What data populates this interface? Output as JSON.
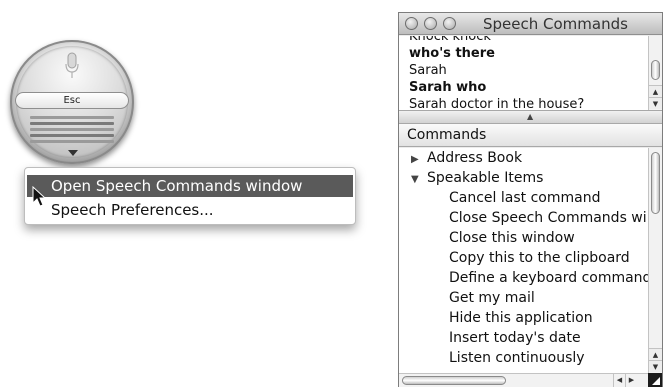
{
  "speech_widget": {
    "esc_label": "Esc",
    "icons": {
      "microphone": "microphone-icon",
      "menu_arrow": "triangle-down-icon"
    }
  },
  "context_menu": {
    "items": [
      {
        "label": "Open Speech Commands window",
        "selected": true
      },
      {
        "label": "Speech Preferences...",
        "selected": false
      }
    ]
  },
  "window": {
    "title": "Speech Commands",
    "log": [
      {
        "text": "Knock knock",
        "bold": false
      },
      {
        "text": "who's there",
        "bold": true
      },
      {
        "text": "Sarah",
        "bold": false
      },
      {
        "text": "Sarah who",
        "bold": true
      },
      {
        "text": "Sarah doctor in the house?",
        "bold": false
      }
    ],
    "commands_header": "Commands",
    "commands": {
      "groups": [
        {
          "label": "Address Book",
          "expanded": false
        },
        {
          "label": "Speakable Items",
          "expanded": true
        }
      ],
      "items": [
        "Cancel last command",
        "Close Speech Commands wi",
        "Close this window",
        "Copy this to the clipboard",
        "Define a keyboard command",
        "Get my mail",
        "Hide this application",
        "Insert today's date",
        "Listen continuously"
      ]
    }
  },
  "colors": {
    "menu_highlight": "#5a5a5a",
    "window_bg": "#ececec"
  }
}
